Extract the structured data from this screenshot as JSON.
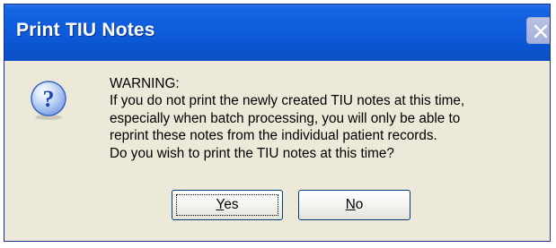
{
  "window": {
    "title": "Print TIU Notes"
  },
  "message": {
    "lines": [
      "WARNING:",
      "If you do not print the newly created TIU notes at this time,",
      "especially when batch processing, you will only be able to",
      "reprint these notes from the individual patient records.",
      "Do you wish to print the TIU notes at this time?"
    ]
  },
  "buttons": {
    "yes": {
      "accel": "Y",
      "rest": "es"
    },
    "no": {
      "accel": "N",
      "rest": "o"
    }
  },
  "icons": {
    "message_icon": "question-icon",
    "close": "close-icon"
  },
  "colors": {
    "titlebar": "#0a55d0",
    "dialog_face": "#ece9d8",
    "question_icon_blue": "#2a5bc8"
  }
}
